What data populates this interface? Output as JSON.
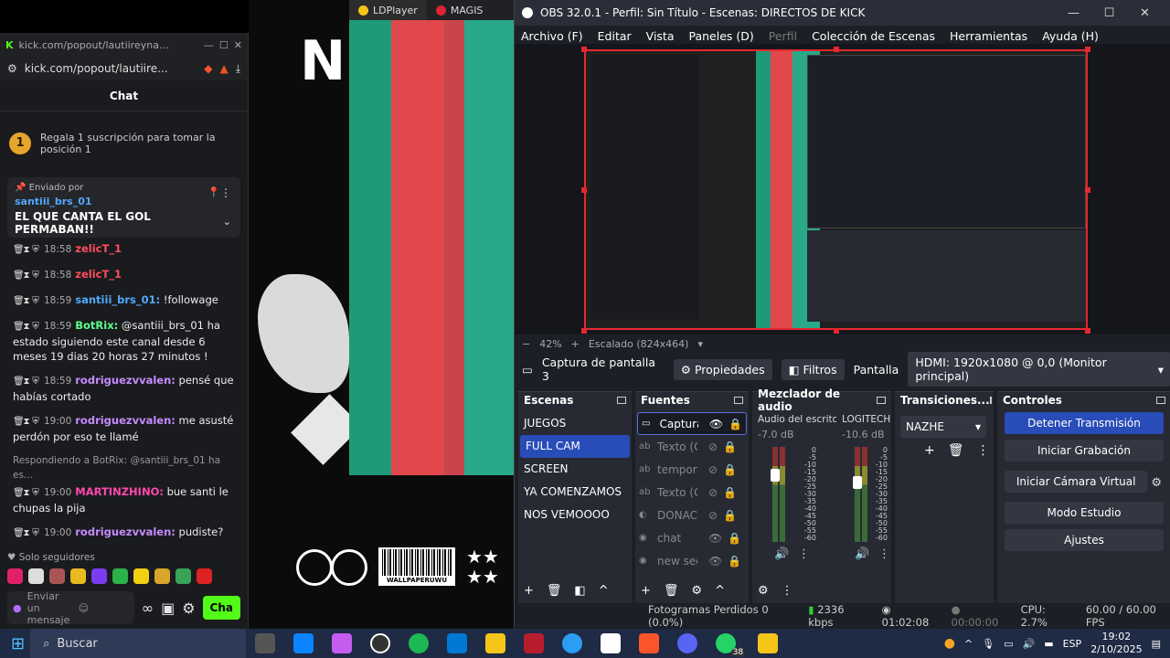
{
  "wallpaper": {
    "big_text": "N",
    "barcode_label": "WALLPAPERUWU",
    "stars": "★★\n★★"
  },
  "ldplayer": {
    "tab1": "LDPlayer",
    "tab2": "MAGIS"
  },
  "browser": {
    "title": "kick.com/popout/lautiireyna...",
    "url": "kick.com/popout/lautiire...",
    "chat_title": "Chat",
    "sub_rank": "1",
    "sub_text": "Regala 1 suscripción para tomar la posición 1",
    "pinned": {
      "header": "Enviado por",
      "user": "santiii_brs_01",
      "message": "EL QUE CANTA EL GOL PERMABAN!!"
    },
    "messages": [
      {
        "time": "18:58",
        "user": "zelicT_1",
        "color": "u-red",
        "text": ""
      },
      {
        "time": "18:58",
        "user": "zelicT_1",
        "color": "u-red",
        "text": ""
      },
      {
        "time": "18:59",
        "user": "santiii_brs_01:",
        "color": "u-blue",
        "text": "!followage"
      },
      {
        "time": "18:59",
        "user": "BotRix:",
        "color": "u-green",
        "text": "@santiii_brs_01 ha estado siguiendo este canal desde 6 meses 19 dias 20 horas 27 minutos !"
      },
      {
        "time": "18:59",
        "user": "rodriguezvvalen:",
        "color": "u-purple",
        "text": "pensé que habías cortado"
      },
      {
        "time": "19:00",
        "user": "rodriguezvvalen:",
        "color": "u-purple",
        "text": "me asusté perdón por eso te llamé"
      },
      {
        "time": "19:00",
        "user": "MARTINZHINO:",
        "color": "u-magenta",
        "text": "bue santi le chupas la pija",
        "reply": "Respondiendo a BotRix: @santiii_brs_01 ha es..."
      },
      {
        "time": "19:00",
        "user": "rodriguezvvalen:",
        "color": "u-purple",
        "text": "pudiste?"
      }
    ],
    "followers_only": "Solo seguidores",
    "input_placeholder": "Enviar un mensaje",
    "chat_button": "Cha"
  },
  "obs": {
    "title": "OBS 32.0.1 - Perfil: Sin Título - Escenas: DIRECTOS DE KICK",
    "menu": [
      "Archivo (F)",
      "Editar",
      "Vista",
      "Paneles (D)",
      "Perfil",
      "Colección de Escenas",
      "Herramientas",
      "Ayuda (H)"
    ],
    "zoom": "42%",
    "scale": "Escalado (824x464)",
    "source_name": "Captura de pantalla 3",
    "properties": "Propiedades",
    "filters": "Filtros",
    "screen_label": "Pantalla",
    "screen_value": "HDMI: 1920x1080 @ 0,0 (Monitor principal)",
    "scenes_title": "Escenas",
    "scenes": [
      "JUEGOS",
      "FULL CAM",
      "SCREEN",
      "YA COMENZAMOS",
      "NOS VEMOOOO"
    ],
    "sources_title": "Fuentes",
    "sources": [
      "Captura",
      "Texto (G",
      "tempori",
      "Texto (G",
      "DONACI",
      "chat",
      "new seg"
    ],
    "mixer_title": "Mezclador de audio",
    "mixer": [
      {
        "name": "Audio del escritorio",
        "db": "-7.0 dB"
      },
      {
        "name": "LOGITECH G",
        "db": "-10.6 dB"
      }
    ],
    "meter_ticks": [
      "0",
      "-5",
      "-10",
      "-15",
      "-20",
      "-25",
      "-30",
      "-35",
      "-40",
      "-45",
      "-50",
      "-55",
      "-60"
    ],
    "transitions_title": "Transiciones...",
    "transition": "NAZHE",
    "controls_title": "Controles",
    "controls": [
      "Detener Transmisión",
      "Iniciar Grabación",
      "Iniciar Cámara Virtual",
      "Modo Estudio",
      "Ajustes"
    ],
    "status": {
      "dropped": "Fotogramas Perdidos 0 (0.0%)",
      "kbps": "2336 kbps",
      "live": "01:02:08",
      "rec": "00:00:00",
      "cpu": "CPU: 2.7%",
      "fps": "60.00 / 60.00 FPS"
    }
  },
  "taskbar": {
    "search": "Buscar",
    "lang": "ESP",
    "time": "19:02",
    "date": "2/10/2025",
    "badge": "38"
  },
  "colors": {
    "accent": "#284cb8",
    "live_red": "#e5282e",
    "kick_green": "#53fc18"
  }
}
